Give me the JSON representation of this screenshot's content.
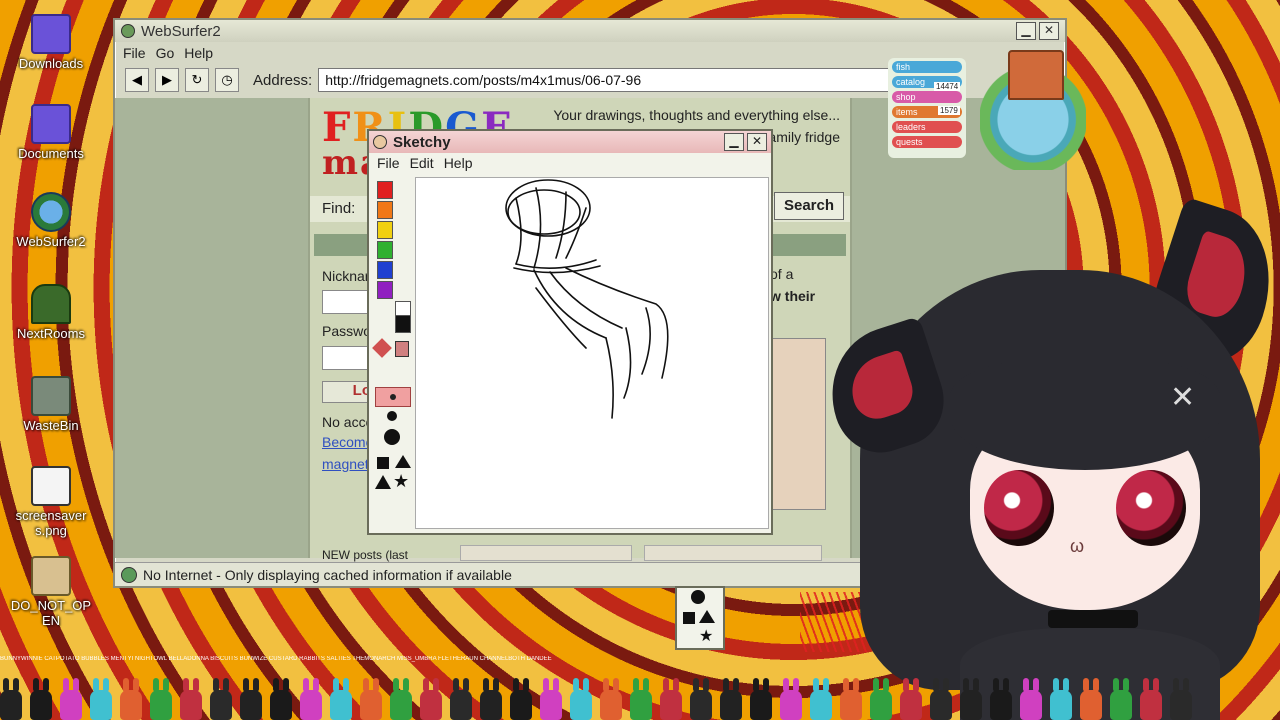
{
  "desktop": {
    "icons": [
      {
        "label": "Downloads"
      },
      {
        "label": "Documents"
      },
      {
        "label": "WebSurfer2"
      },
      {
        "label": "NextRooms"
      },
      {
        "label": "WasteBin"
      },
      {
        "label": "screensaver s.png"
      },
      {
        "label": "DO_NOT_OP EN"
      }
    ]
  },
  "browser": {
    "title": "WebSurfer2",
    "menu": [
      "File",
      "Go",
      "Help"
    ],
    "address_label": "Address:",
    "address": "http://fridgemagnets.com/posts/m4x1mus/06-07-96",
    "minimize": "▁",
    "close": "✕",
    "status": "No Internet - Only displaying cached information if available"
  },
  "page": {
    "logo_letters": [
      "F",
      "R",
      "I",
      "D",
      "G",
      "E"
    ],
    "logo_line2": "ma",
    "tagline_1": "Your drawings, thoughts and everything else...",
    "tagline_2": "amily fridge",
    "find_label": "Find:",
    "search_button": "Search",
    "nickname_label": "Nicknar",
    "password_label": "Passwo",
    "login_button": "Lo",
    "no_account": "No acco",
    "become_link": "Become",
    "magnet_link": "magnet",
    "right_text_1": "of a",
    "right_text_2": "w their",
    "new_posts": "NEW posts (last"
  },
  "sketchy": {
    "title": "Sketchy",
    "menu": [
      "File",
      "Edit",
      "Help"
    ],
    "close": "✕",
    "colors": [
      "#e02020",
      "#f07818",
      "#f0d010",
      "#30b030",
      "#2040d0",
      "#9020c0",
      "#ffffff",
      "#111111"
    ]
  },
  "game_panel": {
    "rows": [
      "fish",
      "catalog",
      "shop",
      "items",
      "leaders",
      "quests"
    ],
    "counters": [
      "14474",
      "1579"
    ],
    "colors": [
      "#4aa8d8",
      "#4aa8d8",
      "#d85aa8",
      "#e07830",
      "#e05050",
      "#e05050"
    ]
  },
  "stream": {
    "chat_names": "BUNNYWINNIE  CATPOTATO  BUBBLES  MENTYI  NIGHTOWL  BELLADONNA  BISCUITS  BUNWIZE  CUSTARD  RABBITS  SALTIES  THEMONARCH  MISS_UMBRA  FLETHERAUN  CHANNELBOTH  DANDEE"
  }
}
